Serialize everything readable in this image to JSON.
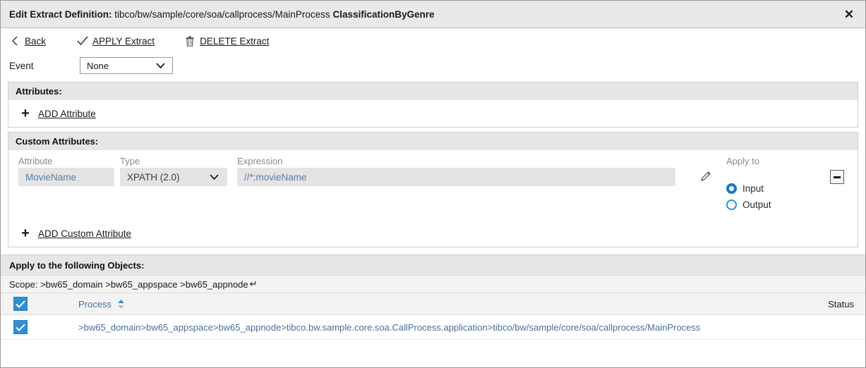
{
  "window": {
    "title_prefix": "Edit Extract Definition:",
    "title_path": "tibco/bw/sample/core/soa/callprocess/MainProcess",
    "title_name": "ClassificationByGenre",
    "close_label": "✕"
  },
  "toolbar": {
    "back_label": "Back",
    "apply_label": "APPLY Extract",
    "delete_label": "DELETE Extract"
  },
  "event": {
    "label": "Event",
    "value": "None",
    "options": [
      "None"
    ]
  },
  "attributes_panel": {
    "header": "Attributes:",
    "add_label": "ADD Attribute",
    "plus": "+"
  },
  "custom_attributes_panel": {
    "header": "Custom Attributes:",
    "labels": {
      "attribute": "Attribute",
      "type": "Type",
      "expression": "Expression",
      "apply_to": "Apply to"
    },
    "row": {
      "attribute": "MovieName",
      "type": "XPATH (2.0)",
      "type_options": [
        "XPATH (2.0)"
      ],
      "expression": "//*:movieName",
      "apply_input": "Input",
      "apply_output": "Output",
      "apply_selected": "Input"
    },
    "add_label": "ADD Custom Attribute",
    "plus": "+"
  },
  "objects_section": {
    "header": "Apply to the following Objects:",
    "scope_label": "Scope: >bw65_domain >bw65_appspace >bw65_appnode",
    "scope_return_glyph": "↵",
    "columns": {
      "process": "Process",
      "status": "Status"
    },
    "rows": [
      {
        "checked": true,
        "process": ">bw65_domain>bw65_appspace>bw65_appnode>tibco.bw.sample.core.soa.CallProcess.application>tibco/bw/sample/core/soa/callprocess/MainProcess",
        "status": ""
      }
    ],
    "header_checked": true
  },
  "colors": {
    "accent_blue": "#2f8ed6",
    "radio_blue": "#1878c2",
    "link_text": "#1a1a1a",
    "field_text": "#5a7fa6",
    "panel_header_bg": "#e6e6e6",
    "titlebar_bg": "#e9e9e9"
  }
}
